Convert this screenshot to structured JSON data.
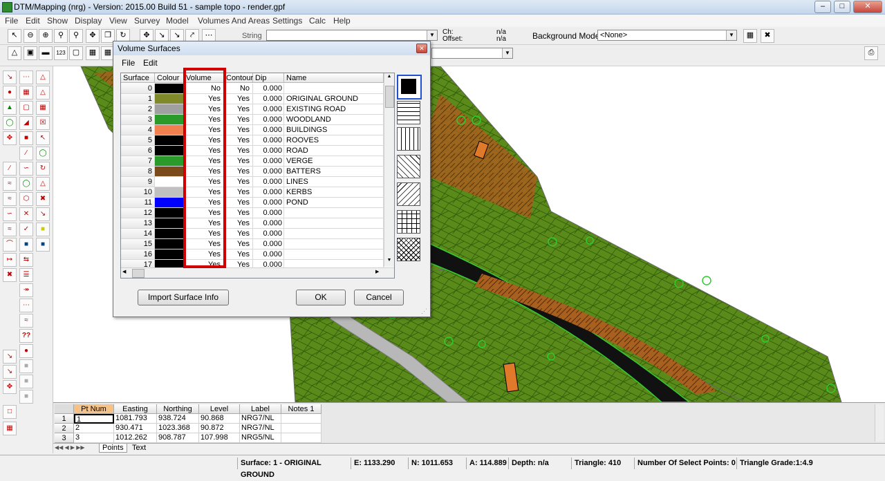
{
  "window": {
    "title": "DTM/Mapping (nrg) - Version: 2015.00 Build 51 - sample topo - render.gpf",
    "min": "–",
    "max": "□",
    "close": "✕"
  },
  "menu": [
    "File",
    "Edit",
    "Show",
    "Display",
    "View",
    "Survey",
    "Model",
    "Volumes And Areas",
    "Settings",
    "Calc",
    "Help"
  ],
  "toolbar": {
    "string_label": "String",
    "ch_label": "Ch:",
    "ch_value": "n/a",
    "offset_label": "Offset:",
    "offset_value": "n/a",
    "background_model_label": "Background Model:",
    "background_model_value": "<None>",
    "btn_123": "123"
  },
  "dialog": {
    "title": "Volume Surfaces",
    "menu": [
      "File",
      "Edit"
    ],
    "columns": [
      "Surface",
      "Colour",
      "Volume",
      "Contour",
      "Dip",
      "Name"
    ],
    "rows": [
      {
        "surface": "0",
        "color": "#000000",
        "volume": "No",
        "contour": "No",
        "dip": "0.000",
        "name": ""
      },
      {
        "surface": "1",
        "color": "#808a2a",
        "volume": "Yes",
        "contour": "Yes",
        "dip": "0.000",
        "name": "ORIGINAL GROUND"
      },
      {
        "surface": "2",
        "color": "#a0a0a0",
        "volume": "Yes",
        "contour": "Yes",
        "dip": "0.000",
        "name": "EXISTING ROAD"
      },
      {
        "surface": "3",
        "color": "#2a9a2a",
        "volume": "Yes",
        "contour": "Yes",
        "dip": "0.000",
        "name": "WOODLAND"
      },
      {
        "surface": "4",
        "color": "#f08050",
        "volume": "Yes",
        "contour": "Yes",
        "dip": "0.000",
        "name": "BUILDINGS"
      },
      {
        "surface": "5",
        "color": "#000000",
        "volume": "Yes",
        "contour": "Yes",
        "dip": "0.000",
        "name": "ROOVES"
      },
      {
        "surface": "6",
        "color": "#000000",
        "volume": "Yes",
        "contour": "Yes",
        "dip": "0.000",
        "name": "ROAD"
      },
      {
        "surface": "7",
        "color": "#2a9a2a",
        "volume": "Yes",
        "contour": "Yes",
        "dip": "0.000",
        "name": "VERGE"
      },
      {
        "surface": "8",
        "color": "#7a4a1a",
        "volume": "Yes",
        "contour": "Yes",
        "dip": "0.000",
        "name": "BATTERS"
      },
      {
        "surface": "9",
        "color": "#ffffff",
        "volume": "Yes",
        "contour": "Yes",
        "dip": "0.000",
        "name": "LINES"
      },
      {
        "surface": "10",
        "color": "#c0c0c0",
        "volume": "Yes",
        "contour": "Yes",
        "dip": "0.000",
        "name": "KERBS"
      },
      {
        "surface": "11",
        "color": "#0000ff",
        "volume": "Yes",
        "contour": "Yes",
        "dip": "0.000",
        "name": "POND"
      },
      {
        "surface": "12",
        "color": "#000000",
        "volume": "Yes",
        "contour": "Yes",
        "dip": "0.000",
        "name": ""
      },
      {
        "surface": "13",
        "color": "#000000",
        "volume": "Yes",
        "contour": "Yes",
        "dip": "0.000",
        "name": ""
      },
      {
        "surface": "14",
        "color": "#000000",
        "volume": "Yes",
        "contour": "Yes",
        "dip": "0.000",
        "name": ""
      },
      {
        "surface": "15",
        "color": "#000000",
        "volume": "Yes",
        "contour": "Yes",
        "dip": "0.000",
        "name": ""
      },
      {
        "surface": "16",
        "color": "#000000",
        "volume": "Yes",
        "contour": "Yes",
        "dip": "0.000",
        "name": ""
      },
      {
        "surface": "17",
        "color": "#000000",
        "volume": "Yes",
        "contour": "Yes",
        "dip": "0.000",
        "name": ""
      }
    ],
    "hatch_patterns": [
      "solid",
      "horizontal",
      "vertical",
      "diagonal-down",
      "diagonal-up",
      "grid",
      "cross-hatch"
    ],
    "buttons": {
      "import": "Import Surface Info",
      "ok": "OK",
      "cancel": "Cancel"
    }
  },
  "points_table": {
    "columns": [
      "Pt Num",
      "Easting",
      "Northing",
      "Level",
      "Label",
      "Notes 1"
    ],
    "rows": [
      {
        "row": "1",
        "pt": "1",
        "easting": "1081.793",
        "northing": "938.724",
        "level": "90.868",
        "label": "NRG7/NL",
        "notes": ""
      },
      {
        "row": "2",
        "pt": "2",
        "easting": "930.471",
        "northing": "1023.368",
        "level": "90.872",
        "label": "NRG7/NL",
        "notes": ""
      },
      {
        "row": "3",
        "pt": "3",
        "easting": "1012.262",
        "northing": "908.787",
        "level": "107.998",
        "label": "NRG5/NL",
        "notes": ""
      }
    ],
    "tabs": [
      "Points",
      "Text"
    ]
  },
  "status": {
    "surface": "Surface: 1 - ORIGINAL GROUND",
    "e": "E: 1133.290",
    "n": "N: 1011.653",
    "a": "A: 114.889",
    "depth": "Depth: n/a",
    "triangle": "Triangle: 410",
    "select": "Number Of Select Points: 0",
    "grade": "Triangle Grade:1:4.9"
  }
}
